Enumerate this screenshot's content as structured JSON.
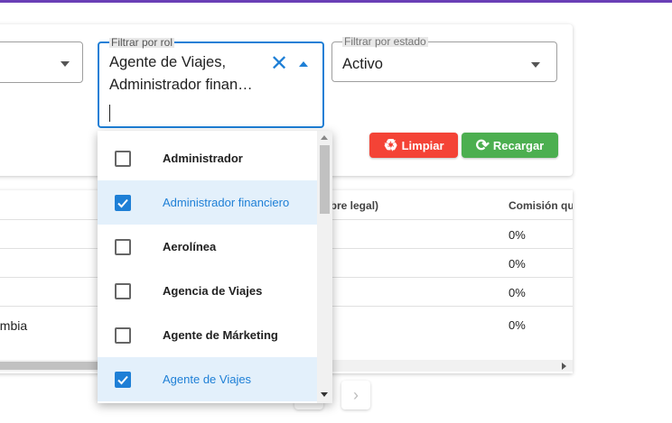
{
  "filters": {
    "rol": {
      "label": "Filtrar por rol",
      "chips_line1": "Agente de Viajes,",
      "chips_line2": "Administrador finan…",
      "clear_icon": "close-icon"
    },
    "estado": {
      "label": "Filtrar por estado",
      "value": "Activo"
    }
  },
  "buttons": {
    "limpiar": "Limpiar",
    "recargar": "Recargar"
  },
  "colors": {
    "accent": "#1e7fd6",
    "limpiar": "#f44336",
    "recargar": "#4caf50",
    "topbar": "#6a3fb6"
  },
  "table": {
    "headers": [
      "mbre legal)",
      "Comisión que"
    ],
    "rows": [
      {
        "left": "",
        "comision": "0%"
      },
      {
        "left": "",
        "comision": "0%"
      },
      {
        "left": "",
        "comision": "0%"
      },
      {
        "left": "ombia",
        "comision": "0%"
      }
    ]
  },
  "pager": {
    "next_icon": "chevron-right-icon"
  },
  "dropdown": {
    "options": [
      {
        "label": "Administrador",
        "checked": false
      },
      {
        "label": "Administrador financiero",
        "checked": true
      },
      {
        "label": "Aerolínea",
        "checked": false
      },
      {
        "label": "Agencia de Viajes",
        "checked": false
      },
      {
        "label": "Agente de Márketing",
        "checked": false
      },
      {
        "label": "Agente de Viajes",
        "checked": true
      }
    ]
  }
}
